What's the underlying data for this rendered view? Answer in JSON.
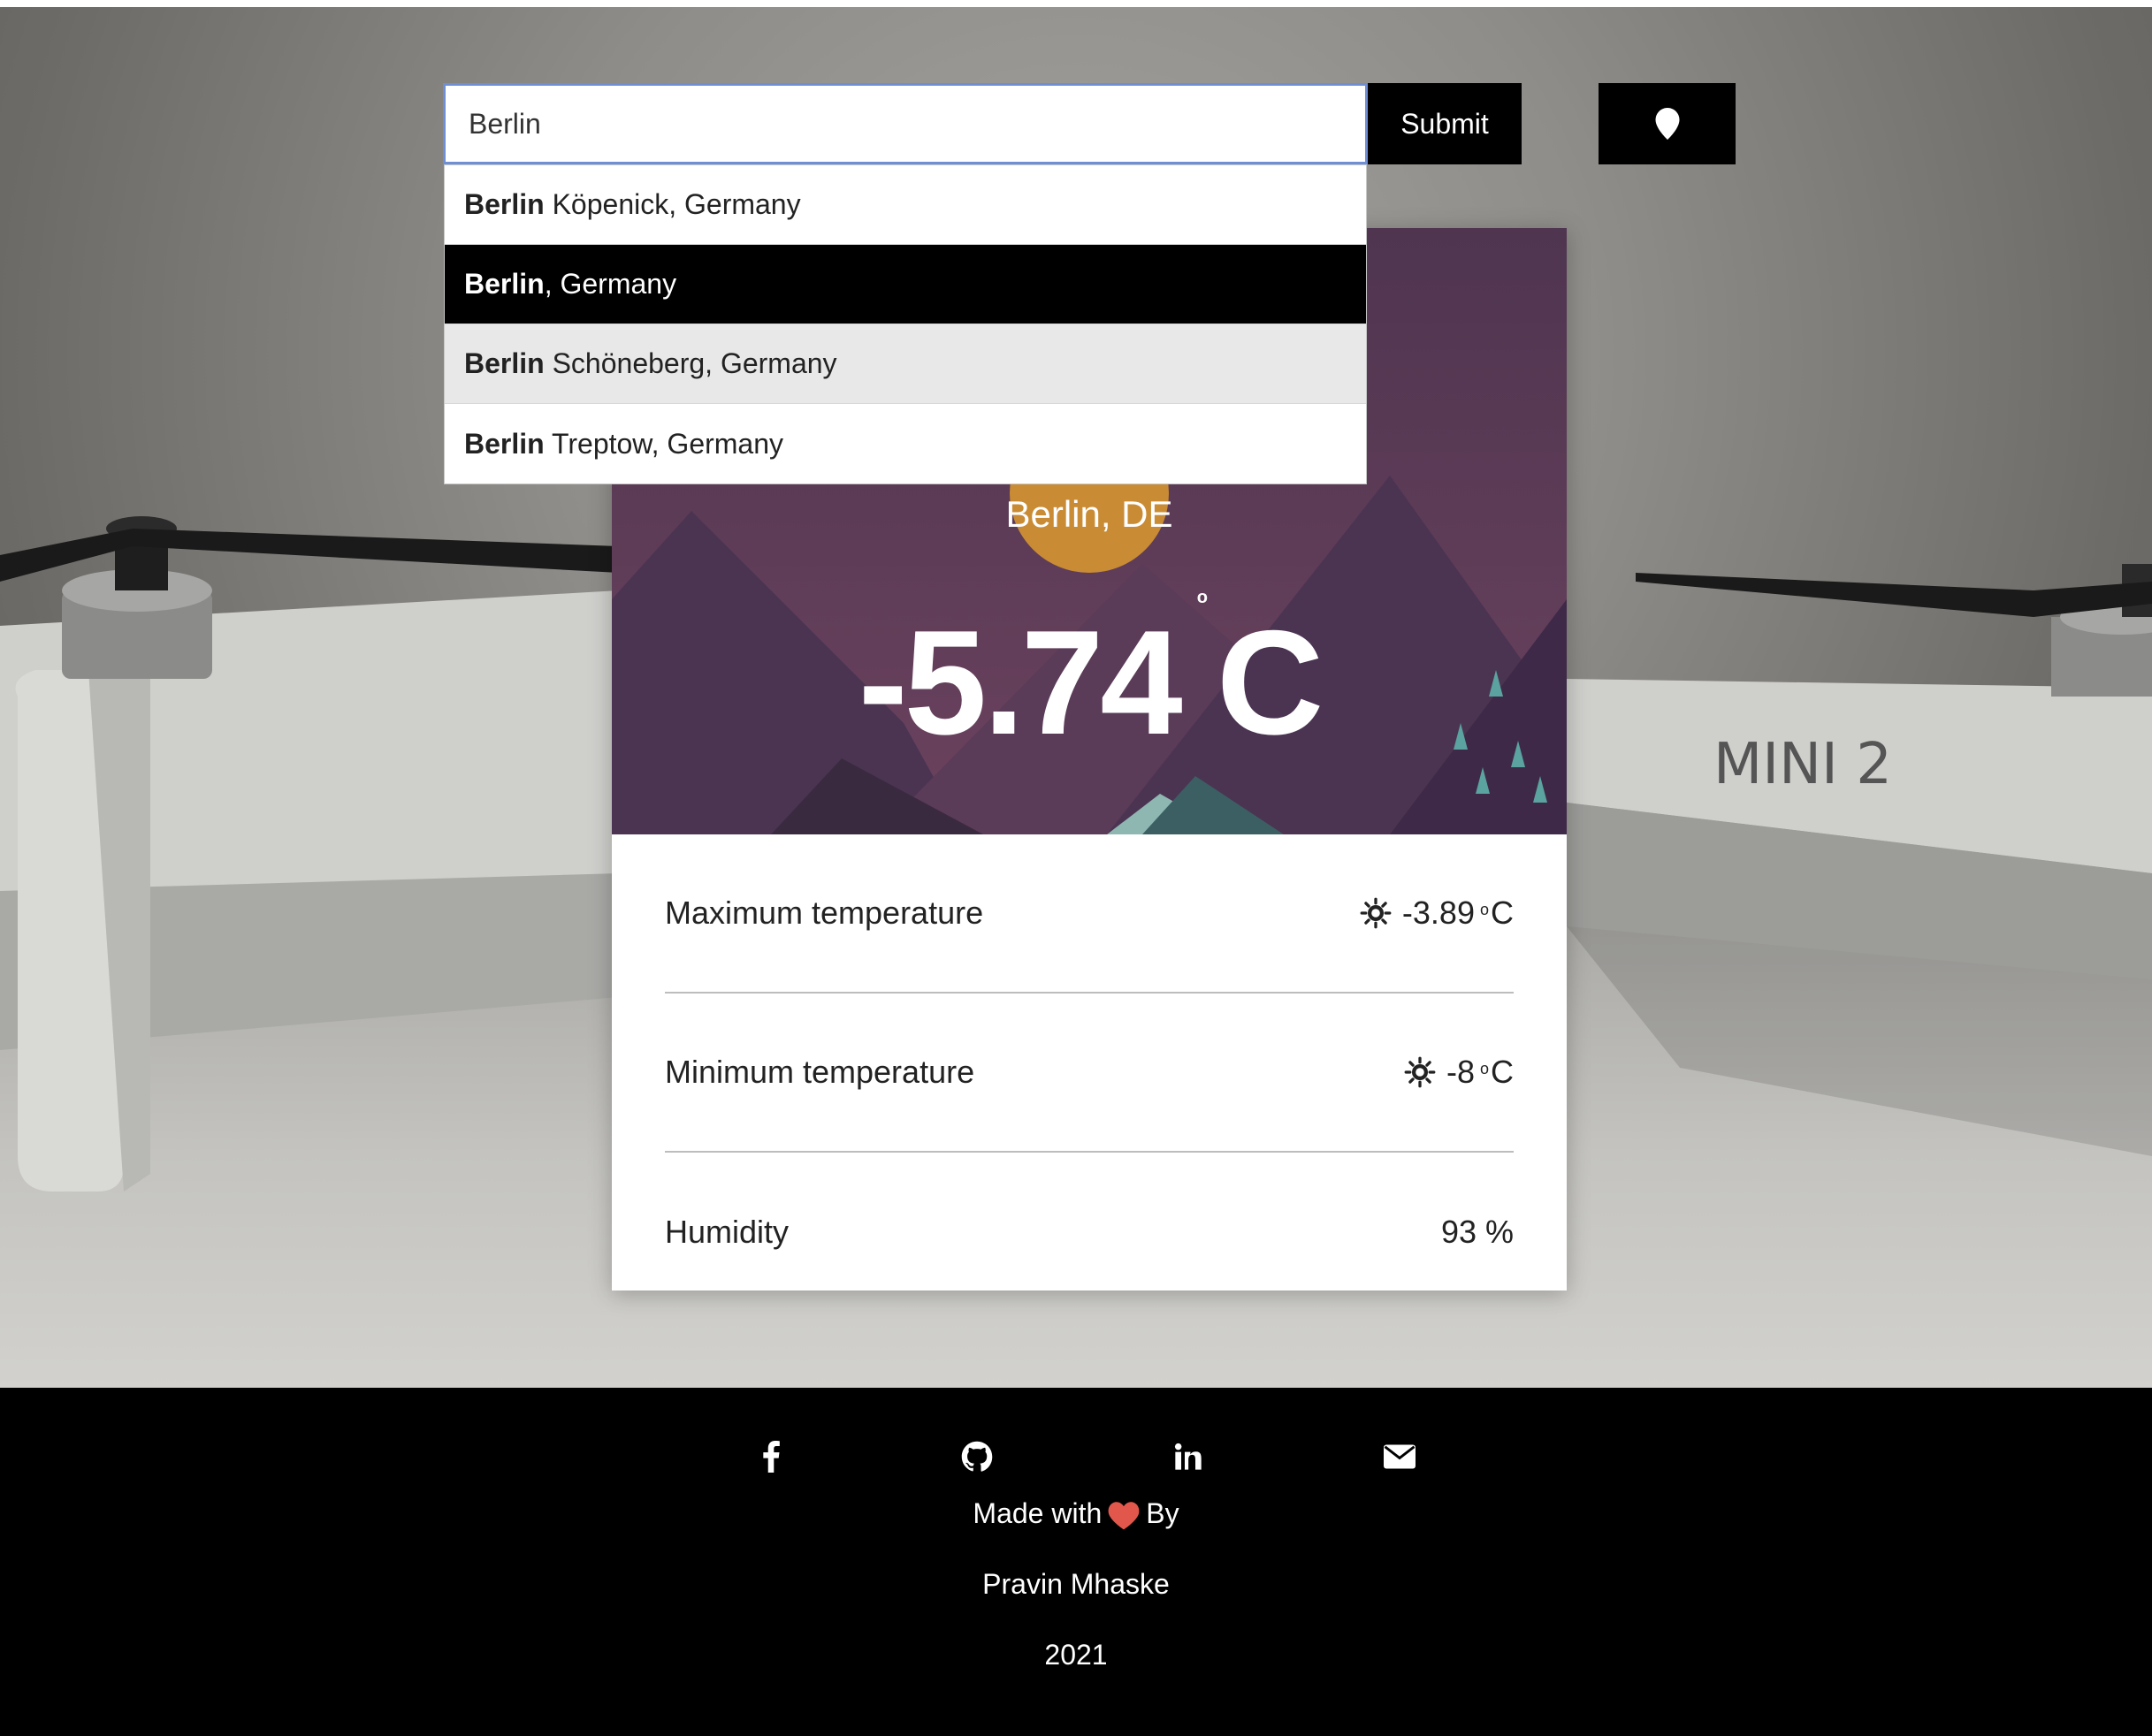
{
  "search": {
    "value": "Berlin",
    "submit_label": "Submit",
    "location_icon": "map-marker-icon",
    "suggestions": [
      {
        "bold": "Berlin",
        "rest": " Köpenick, Germany"
      },
      {
        "bold": "Berlin",
        "rest": ", Germany"
      },
      {
        "bold": "Berlin",
        "rest": " Schöneberg, Germany"
      },
      {
        "bold": "Berlin",
        "rest": " Treptow, Germany"
      }
    ]
  },
  "weather": {
    "city": "Berlin, DE",
    "temperature": "-5.74",
    "temp_degree_mark": "o",
    "temp_unit": "C",
    "rows": [
      {
        "label": "Maximum temperature",
        "icon": "sun-icon",
        "value": "-3.89",
        "sup": "o",
        "unit": "C"
      },
      {
        "label": "Minimum temperature",
        "icon": "sun-icon",
        "value": "-8",
        "sup": "o",
        "unit": "C"
      },
      {
        "label": "Humidity",
        "value": "93 %"
      }
    ]
  },
  "background": {
    "drone_text": "MINI 2"
  },
  "footer": {
    "social_icons": [
      "facebook-icon",
      "github-icon",
      "linkedin-icon",
      "envelope-icon"
    ],
    "made_with": "Made with",
    "by": "By",
    "author": "Pravin Mhaske",
    "year": "2021"
  },
  "colors": {
    "banner_purple": "#63405a",
    "mountain_dark": "#4b3452",
    "sun": "#c98c35",
    "heart": "#e2574c",
    "input_border": "#6e8fd6"
  }
}
